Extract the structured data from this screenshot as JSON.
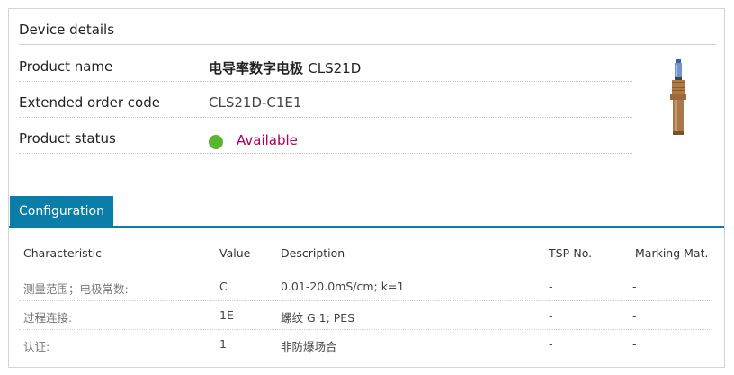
{
  "device_details": {
    "title": "Device details",
    "rows": [
      {
        "label": "Product name",
        "value_cjk": "电导率数字电极",
        "value_model": "CLS21D"
      },
      {
        "label": "Extended order code",
        "value": "CLS21D-C1E1"
      },
      {
        "label": "Product status",
        "value": "Available"
      }
    ],
    "status_color": "#5cb531",
    "status_text_color": "#a8005c"
  },
  "configuration": {
    "tab_label": "Configuration",
    "tab_color": "#0a7ea8",
    "columns": [
      "Characteristic",
      "Value",
      "Description",
      "TSP-No.",
      "Marking Mat."
    ],
    "rows": [
      {
        "characteristic": "测量范围；电极常数:",
        "value": "C",
        "description": "0.01-20.0mS/cm; k=1",
        "tsp": "-",
        "marking": "-"
      },
      {
        "characteristic": "过程连接:",
        "value": "1E",
        "description": "螺纹 G 1; PES",
        "tsp": "-",
        "marking": "-"
      },
      {
        "characteristic": "认证:",
        "value": "1",
        "description": "非防爆场合",
        "tsp": "-",
        "marking": "-"
      }
    ]
  },
  "icons": {
    "product_image": "conductivity-sensor-image",
    "status": "status-dot-icon"
  }
}
